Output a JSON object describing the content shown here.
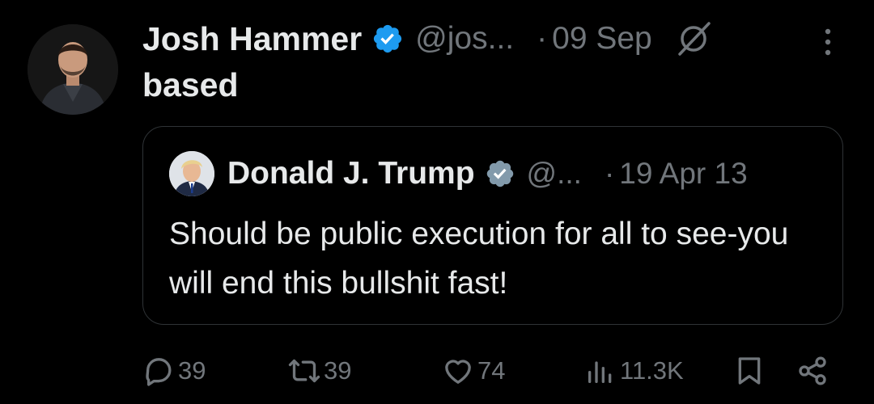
{
  "author": {
    "display_name": "Josh Hammer",
    "handle": "@jos...",
    "date": "09 Sep",
    "separator": "·"
  },
  "tweet": {
    "text": "based"
  },
  "quoted": {
    "display_name": "Donald J. Trump",
    "handle": "@...",
    "date": "19 Apr 13",
    "separator": "·",
    "text": "Should be public execution for all to see-you will end this bullshit fast!"
  },
  "actions": {
    "replies": "39",
    "reposts": "39",
    "likes": "74",
    "views": "11.3K"
  },
  "colors": {
    "background": "#000000",
    "text": "#e7e9ea",
    "muted": "#71767b",
    "verified_author": "#1d9bf0",
    "verified_quoted": "#829aab",
    "border": "#2f3336"
  },
  "icons": {
    "verified": "verified-badge-icon",
    "grok": "grok-icon",
    "more": "more-options-icon",
    "reply": "reply-icon",
    "repost": "repost-icon",
    "like": "like-icon",
    "views": "views-icon",
    "bookmark": "bookmark-icon",
    "share": "share-icon"
  }
}
